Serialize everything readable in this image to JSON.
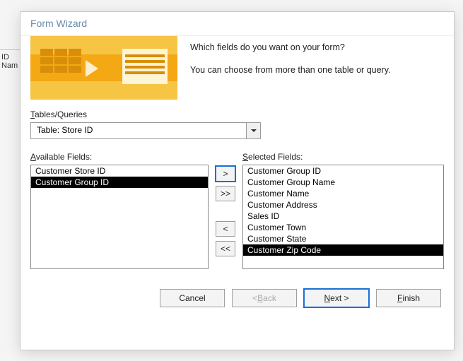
{
  "bg": {
    "line1": "ID",
    "line2": "Nam"
  },
  "dialog": {
    "title": "Form Wizard",
    "heroLine1": "Which fields do you want on your form?",
    "heroLine2": "You can choose from more than one table or query.",
    "tablesLabelPrefix": "T",
    "tablesLabelRest": "ables/Queries",
    "combo": {
      "value": "Table: Store ID"
    },
    "availLabelPrefix": "A",
    "availLabelRest": "vailable Fields:",
    "selLabelPrefix": "S",
    "selLabelRest": "elected Fields:",
    "available": [
      {
        "label": "Customer Store ID",
        "selected": false
      },
      {
        "label": "Customer Group ID",
        "selected": true
      }
    ],
    "selected": [
      {
        "label": "Customer Group ID",
        "selected": false
      },
      {
        "label": "Customer Group Name",
        "selected": false
      },
      {
        "label": "Customer Name",
        "selected": false
      },
      {
        "label": "Customer Address",
        "selected": false
      },
      {
        "label": "Sales ID",
        "selected": false
      },
      {
        "label": "Customer Town",
        "selected": false
      },
      {
        "label": "Customer State",
        "selected": false
      },
      {
        "label": "Customer Zip Code",
        "selected": true
      }
    ],
    "moveBtns": {
      "add": ">",
      "addAll": ">>",
      "remove": "<",
      "removeAll": "<<"
    },
    "buttons": {
      "cancel": "Cancel",
      "backPrefix": "< ",
      "backU": "B",
      "backRest": "ack",
      "nextU": "N",
      "nextRest": "ext >",
      "finishU": "F",
      "finishRest": "inish"
    }
  }
}
